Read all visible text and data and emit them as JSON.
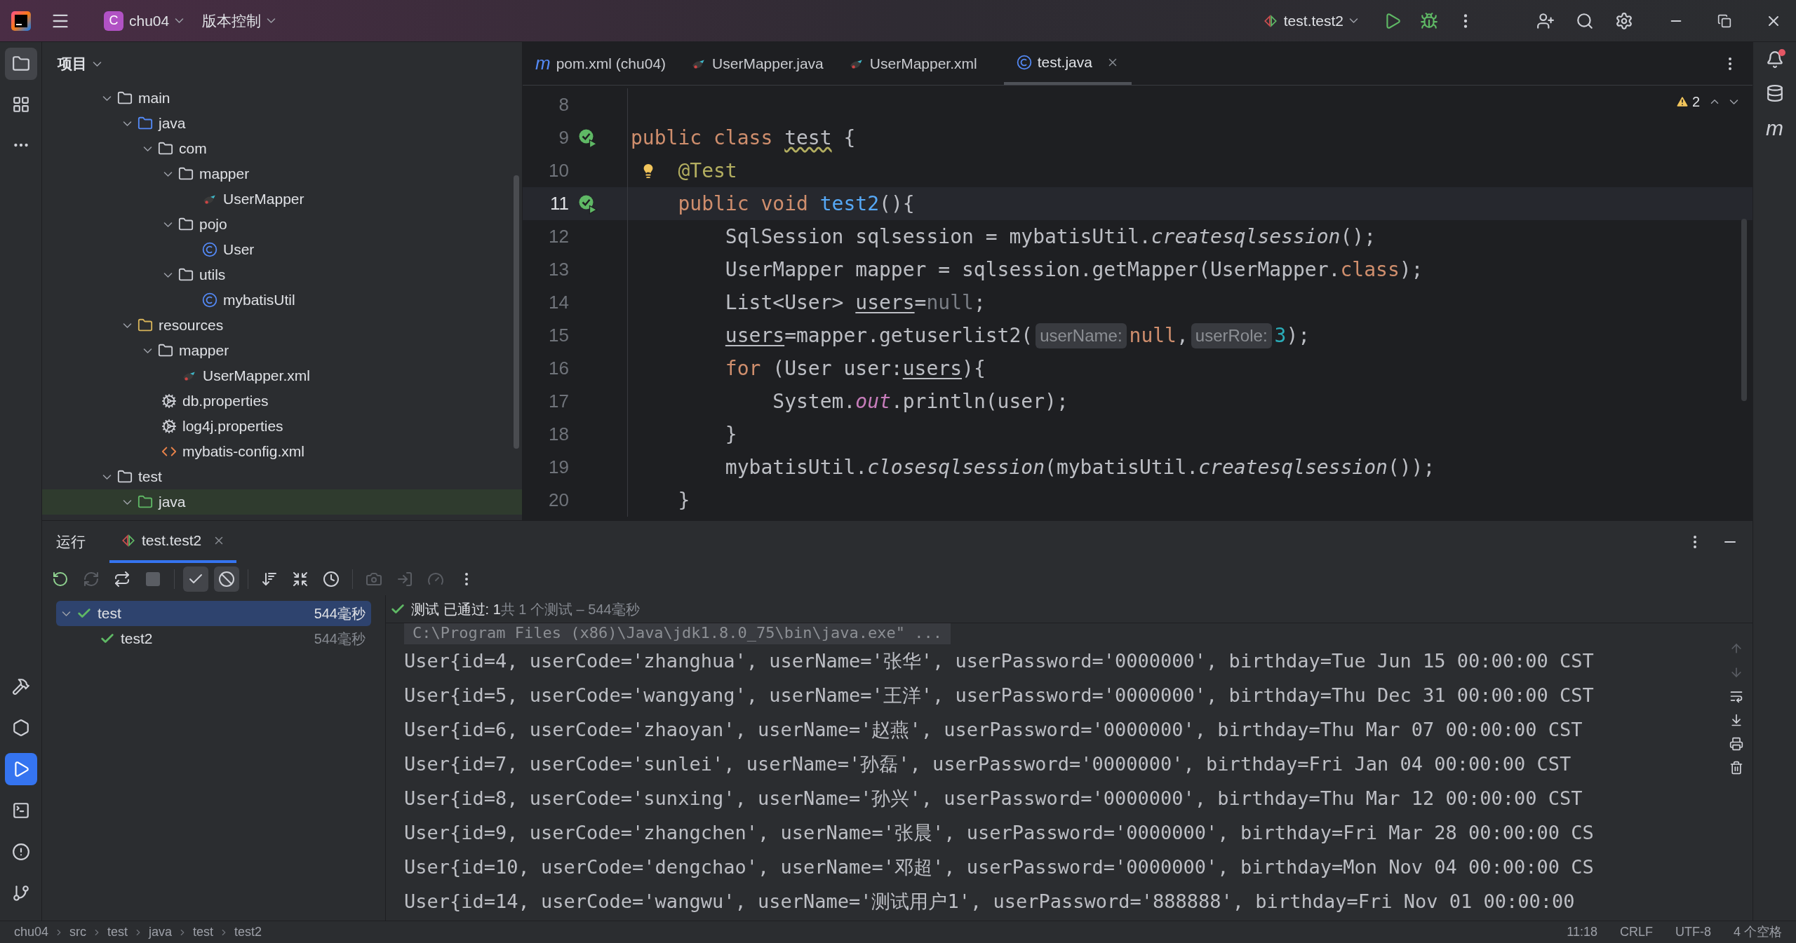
{
  "title_bar": {
    "project_badge": "C",
    "project": "chu04",
    "vcs": "版本控制",
    "run_config": "test.test2"
  },
  "left_strip": {
    "top": [
      {
        "kind": "project",
        "selected": true
      },
      {
        "kind": "structure",
        "selected": false
      },
      {
        "kind": "more",
        "selected": false
      }
    ],
    "bottom": [
      {
        "kind": "build",
        "selected": false
      },
      {
        "kind": "services",
        "selected": false
      },
      {
        "kind": "run",
        "selected": true
      },
      {
        "kind": "terminal",
        "selected": false
      },
      {
        "kind": "problems",
        "selected": false
      },
      {
        "kind": "git",
        "selected": false
      }
    ]
  },
  "right_strip": {
    "notification_dot": true,
    "maven_glyph": "m"
  },
  "project": {
    "title": "项目",
    "tree": [
      {
        "label": "main",
        "kind": "folder",
        "expanded": true,
        "selected": false,
        "children": [
          {
            "label": "java",
            "kind": "source",
            "expanded": true,
            "selected": false,
            "children": [
              {
                "label": "com",
                "kind": "package",
                "expanded": true,
                "selected": false,
                "children": [
                  {
                    "label": "mapper",
                    "kind": "package",
                    "expanded": true,
                    "selected": false,
                    "children": [
                      {
                        "label": "UserMapper",
                        "kind": "mapper",
                        "selected": false
                      }
                    ]
                  },
                  {
                    "label": "pojo",
                    "kind": "package",
                    "expanded": true,
                    "selected": false,
                    "children": [
                      {
                        "label": "User",
                        "kind": "class",
                        "selected": false
                      }
                    ]
                  },
                  {
                    "label": "utils",
                    "kind": "package",
                    "expanded": true,
                    "selected": false,
                    "children": [
                      {
                        "label": "mybatisUtil",
                        "kind": "class",
                        "selected": false
                      }
                    ]
                  }
                ]
              }
            ]
          },
          {
            "label": "resources",
            "kind": "resources",
            "expanded": true,
            "selected": false,
            "children": [
              {
                "label": "mapper",
                "kind": "folder",
                "expanded": true,
                "selected": false,
                "children": [
                  {
                    "label": "UserMapper.xml",
                    "kind": "mapper",
                    "selected": false
                  }
                ]
              },
              {
                "label": "db.properties",
                "kind": "properties",
                "selected": false
              },
              {
                "label": "log4j.properties",
                "kind": "properties",
                "selected": false
              },
              {
                "label": "mybatis-config.xml",
                "kind": "xml",
                "selected": false
              }
            ]
          }
        ]
      },
      {
        "label": "test",
        "kind": "folder",
        "expanded": true,
        "selected": false,
        "children": [
          {
            "label": "java",
            "kind": "test-source",
            "expanded": true,
            "selected": true
          }
        ]
      }
    ]
  },
  "editor": {
    "tabs": [
      {
        "label": "pom.xml (chu04)",
        "kind": "maven",
        "glyph": "m",
        "selected": false
      },
      {
        "label": "UserMapper.java",
        "kind": "mapper",
        "selected": false
      },
      {
        "label": "UserMapper.xml",
        "kind": "mapper",
        "selected": false
      },
      {
        "label": "test.java",
        "kind": "class",
        "selected": true
      }
    ],
    "warnings": "2",
    "lines": [
      {
        "number": "8"
      },
      {
        "number": "9",
        "run": true,
        "tokens": [
          {
            "text": "public class ",
            "kind": "keyword"
          },
          {
            "text": "test",
            "kind": "warning"
          },
          {
            "text": " {",
            "kind": "plain"
          }
        ]
      },
      {
        "number": "10",
        "bulb": true,
        "tokens": [
          {
            "text": "    @Test",
            "kind": "annotation"
          }
        ]
      },
      {
        "number": "11",
        "run": true,
        "current": true,
        "tokens": [
          {
            "text": "    public void ",
            "kind": "keyword"
          },
          {
            "text": "test2",
            "kind": "method"
          },
          {
            "text": "(){",
            "kind": "plain"
          }
        ]
      },
      {
        "number": "12",
        "tokens": [
          {
            "text": "        SqlSession sqlsession = mybatisUtil.",
            "kind": "plain"
          },
          {
            "text": "createsqlsession",
            "kind": "italic"
          },
          {
            "text": "();",
            "kind": "plain"
          }
        ]
      },
      {
        "number": "13",
        "tokens": [
          {
            "text": "        UserMapper mapper = sqlsession.getMapper(UserMapper.",
            "kind": "plain"
          },
          {
            "text": "class",
            "kind": "keyword"
          },
          {
            "text": ");",
            "kind": "plain"
          }
        ]
      },
      {
        "number": "14",
        "tokens": [
          {
            "text": "        List<User> ",
            "kind": "plain"
          },
          {
            "text": "users",
            "kind": "underline"
          },
          {
            "text": "=",
            "kind": "plain"
          },
          {
            "text": "null",
            "kind": "dim"
          },
          {
            "text": ";",
            "kind": "plain"
          }
        ]
      },
      {
        "number": "15",
        "tokens": [
          {
            "text": "        users",
            "kind": "underline"
          },
          {
            "text": "=mapper.getuserlist2(",
            "kind": "plain"
          },
          {
            "text": "userName:",
            "kind": "hint"
          },
          {
            "text": "null",
            "kind": "keyword"
          },
          {
            "text": ",",
            "kind": "plain"
          },
          {
            "text": "userRole:",
            "kind": "hint"
          },
          {
            "text": "3",
            "kind": "number"
          },
          {
            "text": ");",
            "kind": "plain"
          }
        ]
      },
      {
        "number": "16",
        "tokens": [
          {
            "text": "        for",
            "kind": "keyword"
          },
          {
            "text": " (User user:",
            "kind": "plain"
          },
          {
            "text": "users",
            "kind": "underline"
          },
          {
            "text": "){",
            "kind": "plain"
          }
        ]
      },
      {
        "number": "17",
        "tokens": [
          {
            "text": "            System.",
            "kind": "plain"
          },
          {
            "text": "out",
            "kind": "static"
          },
          {
            "text": ".println(user);",
            "kind": "plain"
          }
        ]
      },
      {
        "number": "18",
        "tokens": [
          {
            "text": "        }",
            "kind": "plain"
          }
        ]
      },
      {
        "number": "19",
        "tokens": [
          {
            "text": "        mybatisUtil.",
            "kind": "plain"
          },
          {
            "text": "closesqlsession",
            "kind": "italic"
          },
          {
            "text": "(mybatisUtil.",
            "kind": "plain"
          },
          {
            "text": "createsqlsession",
            "kind": "italic"
          },
          {
            "text": "());",
            "kind": "plain"
          }
        ]
      },
      {
        "number": "20",
        "tokens": [
          {
            "text": "    }",
            "kind": "plain"
          }
        ]
      }
    ]
  },
  "run": {
    "label": "运行",
    "tab": {
      "label": "test.test2",
      "selected": true
    },
    "toolbar": [
      {
        "kind": "rerun",
        "disabled": false,
        "on": false
      },
      {
        "kind": "rerun-failed",
        "disabled": true,
        "on": false
      },
      {
        "kind": "toggle-auto",
        "disabled": false,
        "on": false
      },
      {
        "kind": "stop",
        "disabled": true,
        "on": false
      },
      {
        "kind": "show-passed",
        "disabled": false,
        "on": true
      },
      {
        "kind": "show-ignored",
        "disabled": false,
        "on": true
      },
      {
        "kind": "sort",
        "disabled": false,
        "on": false
      },
      {
        "kind": "collapse",
        "disabled": false,
        "on": false
      },
      {
        "kind": "history",
        "disabled": false,
        "on": false
      },
      {
        "kind": "snapshot",
        "disabled": true,
        "on": false
      },
      {
        "kind": "import",
        "disabled": true,
        "on": false
      },
      {
        "kind": "coverage",
        "disabled": true,
        "on": false
      },
      {
        "kind": "more",
        "disabled": false,
        "on": false
      }
    ],
    "tests": [
      {
        "label": "test",
        "duration": "544毫秒",
        "passed": true,
        "selected": true,
        "expanded": true,
        "children": [
          {
            "label": "test2",
            "duration": "544毫秒",
            "passed": true,
            "selected": false
          }
        ]
      }
    ],
    "summary": "测试 已通过: 1",
    "summary_detail": "共 1 个测试 – 544毫秒",
    "command": "C:\\Program Files (x86)\\Java\\jdk1.8.0_75\\bin\\java.exe\" ...",
    "output": [
      "User{id=4, userCode='zhanghua', userName='张华', userPassword='0000000', birthday=Tue Jun 15 00:00:00 CST",
      "User{id=5, userCode='wangyang', userName='王洋', userPassword='0000000', birthday=Thu Dec 31 00:00:00 CST",
      "User{id=6, userCode='zhaoyan', userName='赵燕', userPassword='0000000', birthday=Thu Mar 07 00:00:00 CST",
      "User{id=7, userCode='sunlei', userName='孙磊', userPassword='0000000', birthday=Fri Jan 04 00:00:00 CST",
      "User{id=8, userCode='sunxing', userName='孙兴', userPassword='0000000', birthday=Thu Mar 12 00:00:00 CST",
      "User{id=9, userCode='zhangchen', userName='张晨', userPassword='0000000', birthday=Fri Mar 28 00:00:00 CS",
      "User{id=10, userCode='dengchao', userName='邓超', userPassword='0000000', birthday=Mon Nov 04 00:00:00 CS",
      "User{id=14, userCode='wangwu', userName='测试用户1', userPassword='888888', birthday=Fri Nov 01 00:00:00"
    ]
  },
  "status_bar": {
    "breadcrumbs": [
      "chu04",
      "src",
      "test",
      "java",
      "test",
      "test2"
    ],
    "items": [
      "11:18",
      "CRLF",
      "UTF-8",
      "4 个空格"
    ]
  }
}
